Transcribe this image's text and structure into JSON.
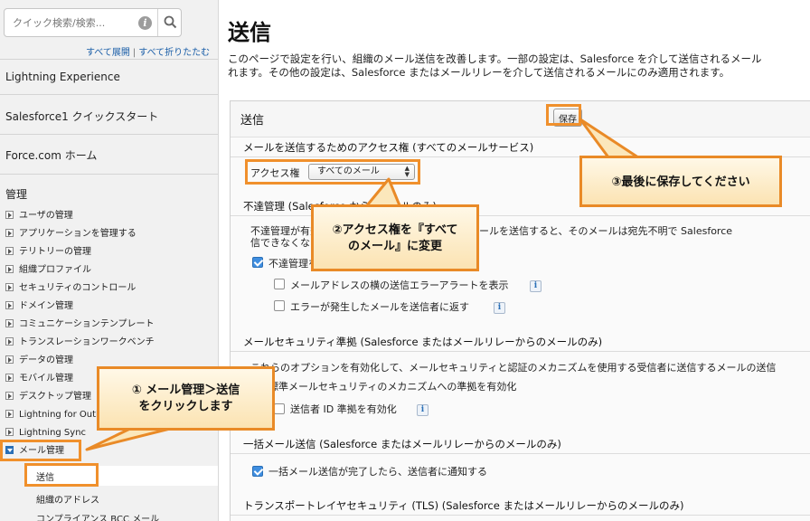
{
  "sidebar": {
    "search_placeholder": "クイック検索/検索...",
    "expand_all": "すべて展開",
    "collapse_all": "すべて折りたたむ",
    "sections": [
      "Lightning Experience",
      "Salesforce1 クイックスタート",
      "Force.com ホーム",
      "管理"
    ],
    "admin_items": [
      "ユーザの管理",
      "アプリケーションを管理する",
      "テリトリーの管理",
      "組織プロファイル",
      "セキュリティのコントロール",
      "ドメイン管理",
      "コミュニケーションテンプレート",
      "トランスレーションワークベンチ",
      "データの管理",
      "モバイル管理",
      "デスクトップ管理",
      "Lightning for Outlook",
      "Lightning Sync"
    ],
    "email_admin": "メール管理",
    "email_sub_items": [
      "送信",
      "組織のアドレス",
      "コンプライアンス BCC メール"
    ]
  },
  "main": {
    "title": "送信",
    "desc_line1": "このページで設定を行い、組織のメール送信を改善します。一部の設定は、Salesforce を介して送信されるメール",
    "desc_line2": "れます。その他の設定は、Salesforce またはメールリレーを介して送信されるメールにのみ適用されます。",
    "panel_title": "送信",
    "save_label": "保存",
    "access_section_title": "メールを送信するためのアクセス権 (すべてのメールサービス)",
    "access_label": "アクセス権",
    "access_value": "すべてのメール",
    "bounce_section_title": "不達管理 (Salesforce からのメールのみ)",
    "bounce_text1": "不達管理が有効な場合、無効なメールアドレスにメールを送信すると、そのメールは宛先不明で Salesforce",
    "bounce_text2": "信できなくなります。",
    "bounce_checkbox": "不達管理を有効化",
    "bounce_alert": "メールアドレスの横の送信エラーアラートを表示",
    "bounce_return": "エラーが発生したメールを送信者に返す",
    "security_section_title": "メールセキュリティ準拠 (Salesforce またはメールリレーからのメールのみ)",
    "security_text": "これらのオプションを有効化して、メールセキュリティと認証のメカニズムを使用する受信者に送信するメールの送信",
    "security_checkbox1": "標準メールセキュリティのメカニズムへの準拠を有効化",
    "security_checkbox2": "送信者 ID 準拠を有効化",
    "bulk_section_title": "一括メール送信 (Salesforce またはメールリレーからのメールのみ)",
    "bulk_checkbox": "一括メール送信が完了したら、送信者に通知する",
    "tls_section_title": "トランスポートレイヤセキュリティ (TLS) (Salesforce またはメールリレーからのメールのみ)"
  },
  "callouts": {
    "step1_line1": "① メール管理＞送信",
    "step1_line2": "をクリックします",
    "step2_line1": "②アクセス権を『すべて",
    "step2_line2": "のメール』に変更",
    "step3": "③最後に保存してください"
  },
  "colors": {
    "highlight": "#f0902c",
    "link": "#1a5ea8",
    "checkbox_checked": "#3f8ee0"
  },
  "checkbox_states": {
    "bounce_enable": true,
    "bounce_alert": false,
    "bounce_return": false,
    "security_standard": true,
    "security_sender_id": false,
    "bulk_notify": true
  }
}
